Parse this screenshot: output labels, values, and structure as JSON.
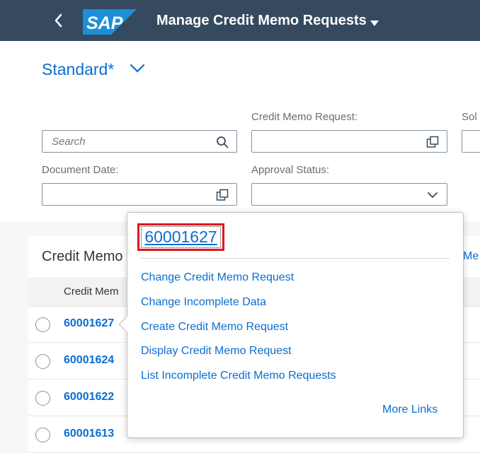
{
  "shell": {
    "title": "Manage Credit Memo Requests",
    "logo_text": "SAP",
    "colors": {
      "bar": "#354a5f",
      "logo": "#1d8fd6"
    }
  },
  "filters": {
    "variant": "Standard*",
    "search_placeholder": "Search",
    "credit_memo_request_label": "Credit Memo Request:",
    "sold_to_label_truncated": "Sol",
    "document_date_label": "Document Date:",
    "approval_status_label": "Approval Status:"
  },
  "table": {
    "title_truncated": "Credit Memo",
    "more_truncated": "Me",
    "column_header_truncated": "Credit Mem",
    "rows": [
      {
        "id": "60001627"
      },
      {
        "id": "60001624"
      },
      {
        "id": "60001622"
      },
      {
        "id": "60001613"
      }
    ]
  },
  "popover": {
    "main_link": "60001627",
    "links": [
      "Change Credit Memo Request",
      "Change Incomplete Data",
      "Create Credit Memo Request",
      "Display Credit Memo Request",
      "List Incomplete Credit Memo Requests"
    ],
    "more_links": "More Links",
    "highlight_color": "#e3141e"
  }
}
